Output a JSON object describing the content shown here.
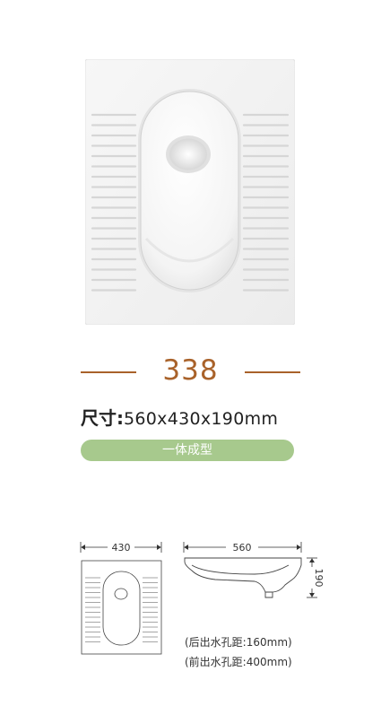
{
  "product": {
    "model": "338",
    "size_label": "尺寸:",
    "size_value": "560x430x190mm",
    "feature": "一体成型"
  },
  "diagram": {
    "width_label": "430",
    "length_label": "560",
    "height_label": "190",
    "back_drain_note": "(后出水孔距:160mm)",
    "front_drain_note": "(前出水孔距:400mm)"
  },
  "colors": {
    "accent_brown": "#a9622a",
    "pill_green": "#a7c98d",
    "background": "#ffffff"
  },
  "icons": [
    "squat-toilet-photo",
    "squat-toilet-top-view-icon",
    "squat-toilet-side-view-icon"
  ]
}
